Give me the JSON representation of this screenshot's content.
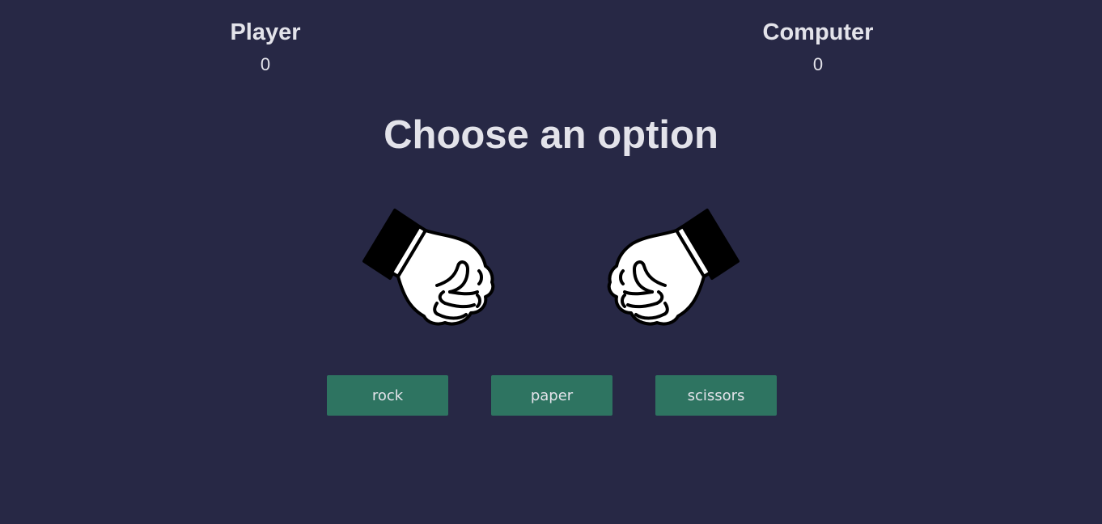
{
  "player": {
    "title": "Player",
    "score": "0"
  },
  "computer": {
    "title": "Computer",
    "score": "0"
  },
  "headline": "Choose an option",
  "hands": {
    "player": {
      "icon": "rock-fist-icon"
    },
    "computer": {
      "icon": "rock-fist-icon"
    }
  },
  "choices": [
    {
      "label": "rock"
    },
    {
      "label": "paper"
    },
    {
      "label": "scissors"
    }
  ],
  "colors": {
    "background": "#272845",
    "text": "#e3e3ea",
    "button": "#2e7461"
  }
}
